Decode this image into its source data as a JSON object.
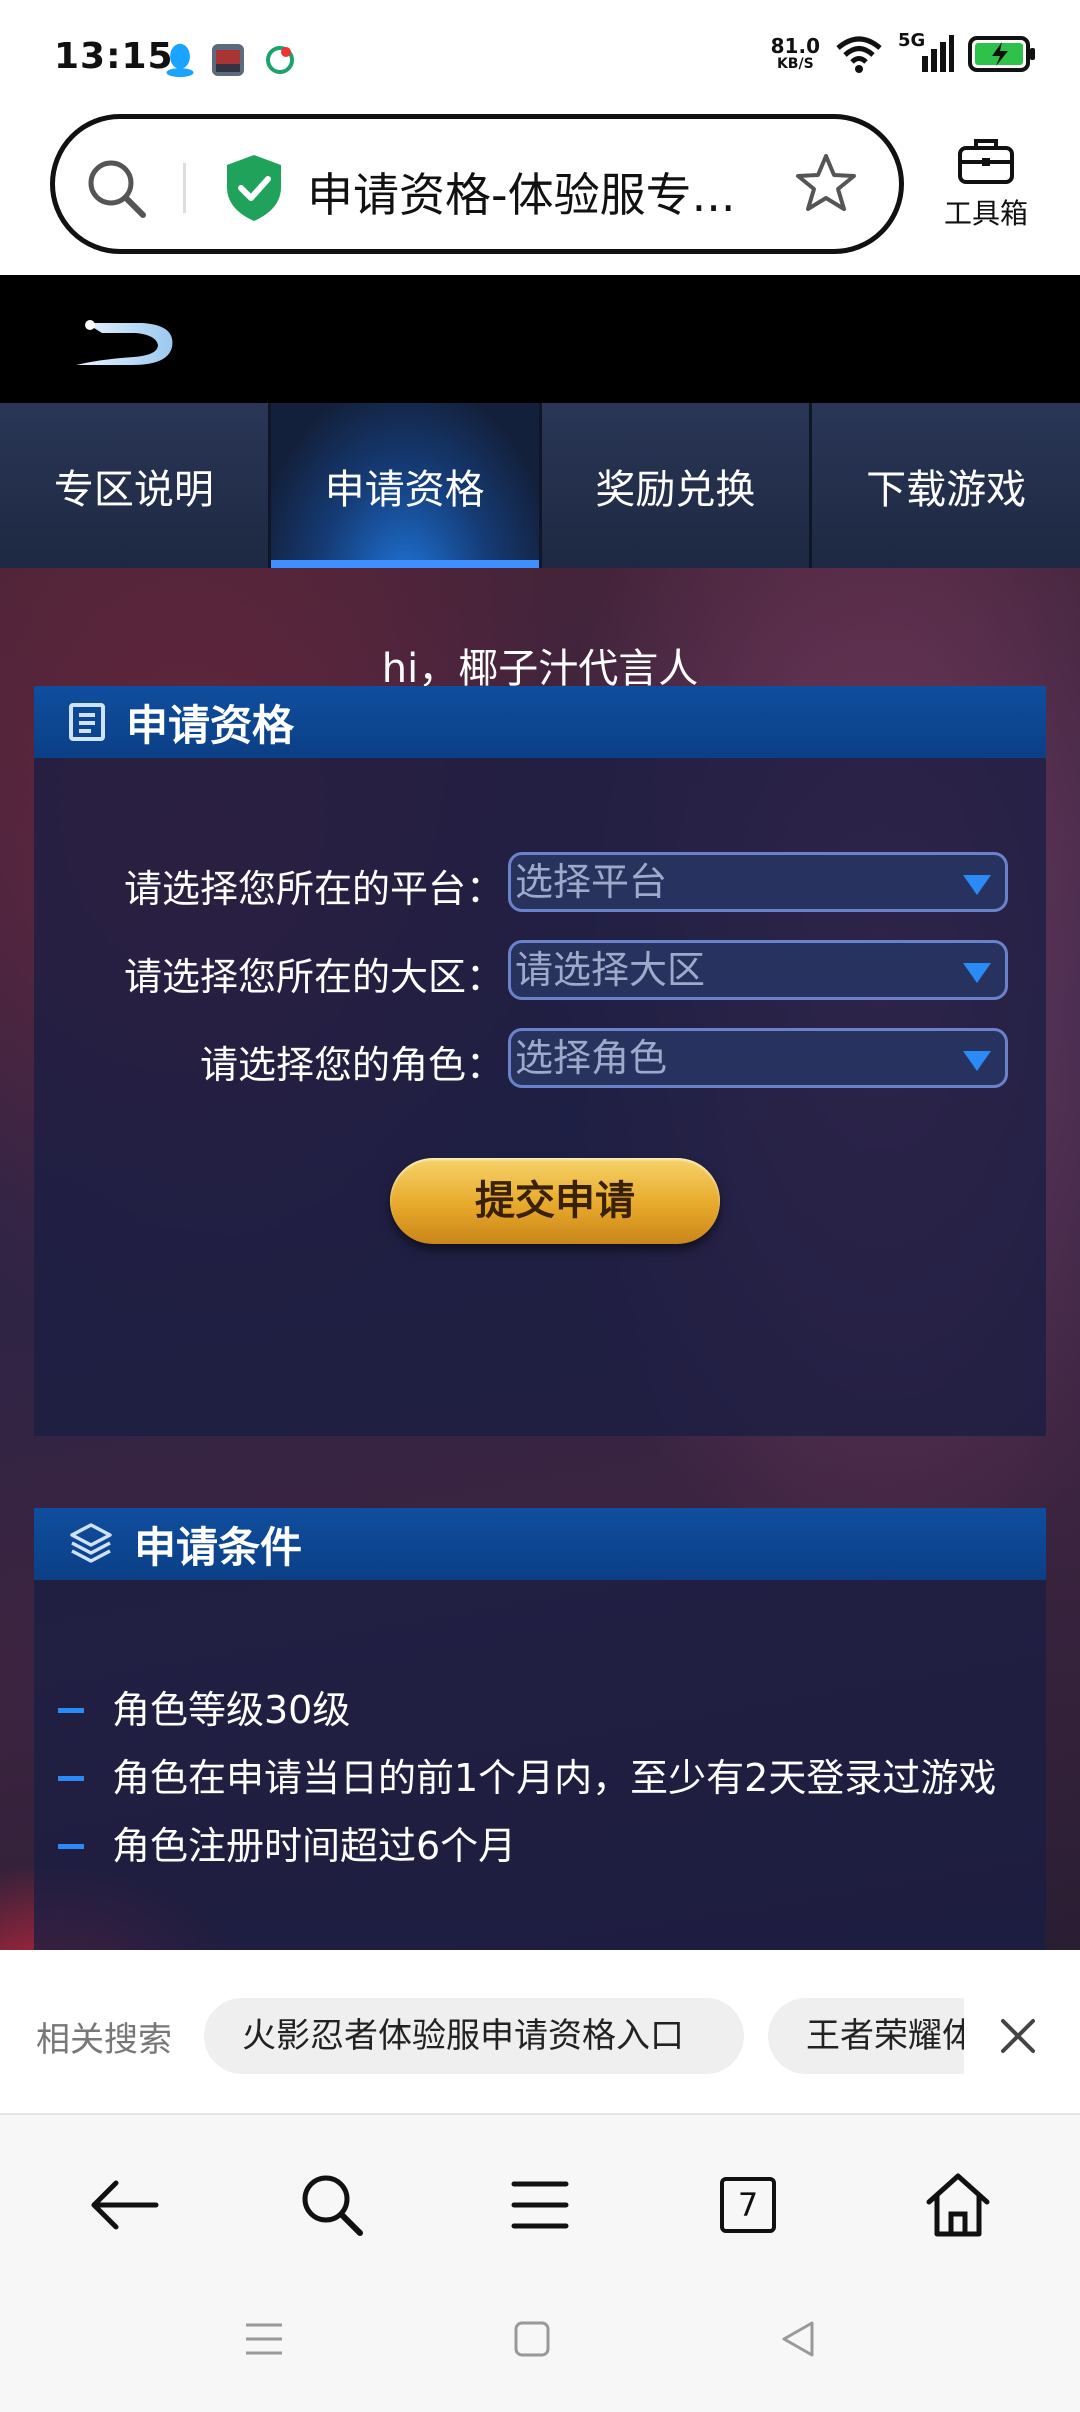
{
  "status_bar": {
    "time": "13:15",
    "net_speed": "81.0",
    "net_unit": "KB/S",
    "network": "5G"
  },
  "browser": {
    "page_title": "申请资格-体验服专...",
    "toolbox_label": "工具箱"
  },
  "tabs": [
    {
      "label": "专区说明",
      "active": false
    },
    {
      "label": "申请资格",
      "active": true
    },
    {
      "label": "奖励兑换",
      "active": false
    },
    {
      "label": "下载游戏",
      "active": false
    }
  ],
  "greeting": "hi，椰子汁代言人",
  "apply_panel": {
    "title": "申请资格",
    "fields": [
      {
        "label": "请选择您所在的平台：",
        "value": "选择平台"
      },
      {
        "label": "请选择您所在的大区：",
        "value": "请选择大区"
      },
      {
        "label": "请选择您的角色：",
        "value": "选择角色"
      }
    ],
    "submit_label": "提交申请"
  },
  "conditions_panel": {
    "title": "申请条件",
    "items": [
      "角色等级30级",
      "角色在申请当日的前1个月内，至少有2天登录过游戏",
      "角色注册时间超过6个月"
    ]
  },
  "related_search": {
    "label": "相关搜索",
    "chips": [
      "火影忍者体验服申请资格入口",
      "王者荣耀体验服"
    ]
  },
  "bottom_nav": {
    "tab_count": "7"
  },
  "colors": {
    "accent_blue": "#2a8af6",
    "panel_header": "#0f4e9e",
    "submit_gold": "#e7a92a",
    "secure_green": "#1fa35a"
  }
}
